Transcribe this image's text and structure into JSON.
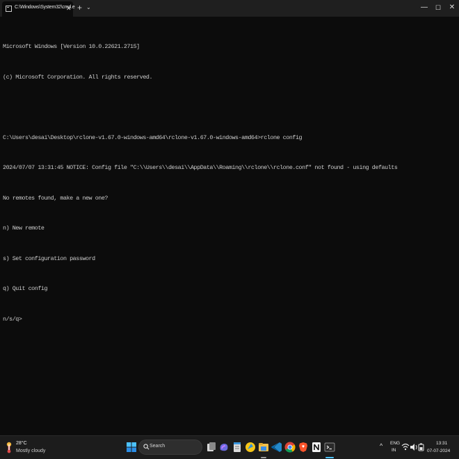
{
  "window": {
    "tab_title": "C:\\Windows\\System32\\cmd.e",
    "tab_close": "✕",
    "new_tab": "+",
    "dropdown": "⌄",
    "minimize": "—",
    "maximize": "☐",
    "close": "✕"
  },
  "terminal": {
    "lines": [
      "Microsoft Windows [Version 10.0.22621.2715]",
      "(c) Microsoft Corporation. All rights reserved.",
      "",
      "C:\\Users\\desai\\Desktop\\rclone-v1.67.0-windows-amd64\\rclone-v1.67.0-windows-amd64>rclone config",
      "2024/07/07 13:31:45 NOTICE: Config file \"C:\\\\Users\\\\desai\\\\AppData\\\\Roaming\\\\rclone\\\\rclone.conf\" not found - using defaults",
      "No remotes found, make a new one?",
      "n) New remote",
      "s) Set configuration password",
      "q) Quit config",
      "n/s/q>"
    ]
  },
  "taskbar": {
    "weather": {
      "temperature": "28°C",
      "description": "Mostly cloudy",
      "icon": "weather-cloud-sun-icon"
    },
    "search_placeholder": "Search",
    "pinned_icons": [
      "windows-start-icon",
      "search-icon",
      "task-view-icon",
      "copilot-icon",
      "notepad-icon",
      "sticky-icon",
      "file-explorer-icon",
      "vscode-icon",
      "chrome-icon",
      "brave-icon",
      "notion-icon",
      "terminal-icon"
    ],
    "tray": {
      "chevron": "^",
      "language_top": "ENG",
      "language_bottom": "IN",
      "time": "13:31",
      "date": "07-07-2024"
    }
  },
  "colors": {
    "terminal_bg": "#0c0c0c",
    "terminal_text": "#cccccc",
    "taskbar_bg": "#1c1c1c",
    "titlebar_bg": "#1f1f1f"
  }
}
